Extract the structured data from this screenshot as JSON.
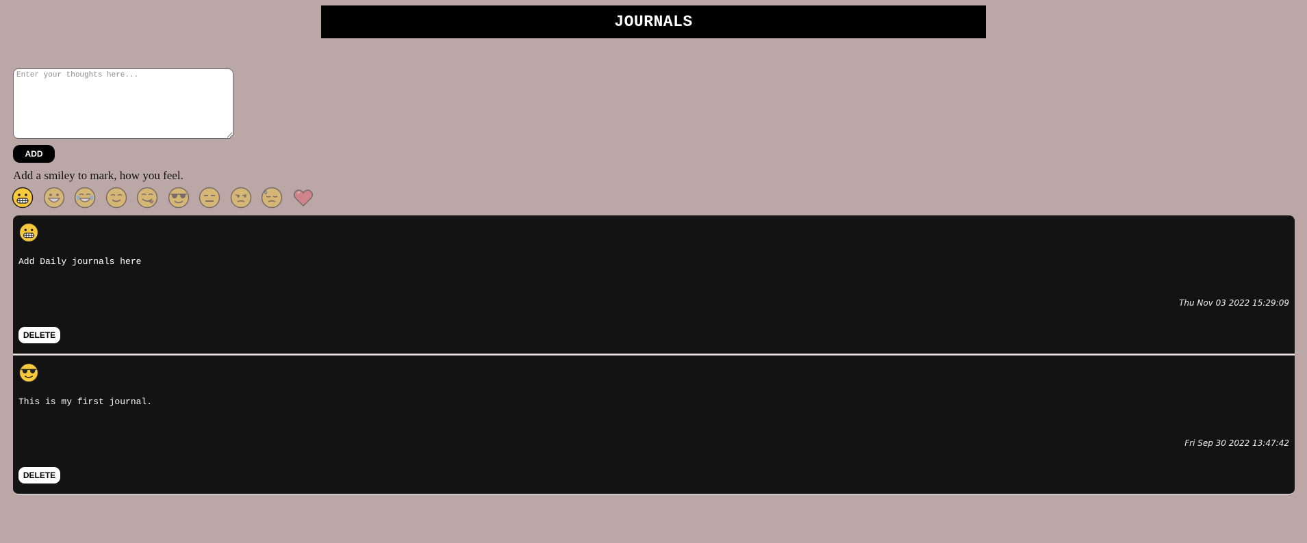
{
  "header": {
    "title": "JOURNALS"
  },
  "composer": {
    "placeholder": "Enter your thoughts here...",
    "add_label": "ADD",
    "hint": "Add a smiley to mark, how you feel."
  },
  "smileys": [
    {
      "icon": "grimacing-face-icon",
      "selected": true
    },
    {
      "icon": "grinning-face-icon",
      "selected": false
    },
    {
      "icon": "tears-of-joy-face-icon",
      "selected": false
    },
    {
      "icon": "smiling-face-icon",
      "selected": false
    },
    {
      "icon": "savoring-food-face-icon",
      "selected": false
    },
    {
      "icon": "sunglasses-face-icon",
      "selected": false
    },
    {
      "icon": "expressionless-face-icon",
      "selected": false
    },
    {
      "icon": "unamused-face-icon",
      "selected": false
    },
    {
      "icon": "downcast-sweat-face-icon",
      "selected": false
    },
    {
      "icon": "heart-icon",
      "selected": false
    }
  ],
  "entries": [
    {
      "icon": "grimacing-face-icon",
      "text": "Add Daily journals here",
      "date": "Thu Nov 03 2022 15:29:09",
      "delete_label": "DELETE"
    },
    {
      "icon": "sunglasses-face-icon",
      "text": "This is my first journal.",
      "date": "Fri Sep 30 2022 13:47:42",
      "delete_label": "DELETE"
    }
  ],
  "colors": {
    "background": "#bba8a6",
    "entry_bg": "#141313",
    "header_bg": "#000000",
    "emoji_yellow": "#f8c93c"
  }
}
